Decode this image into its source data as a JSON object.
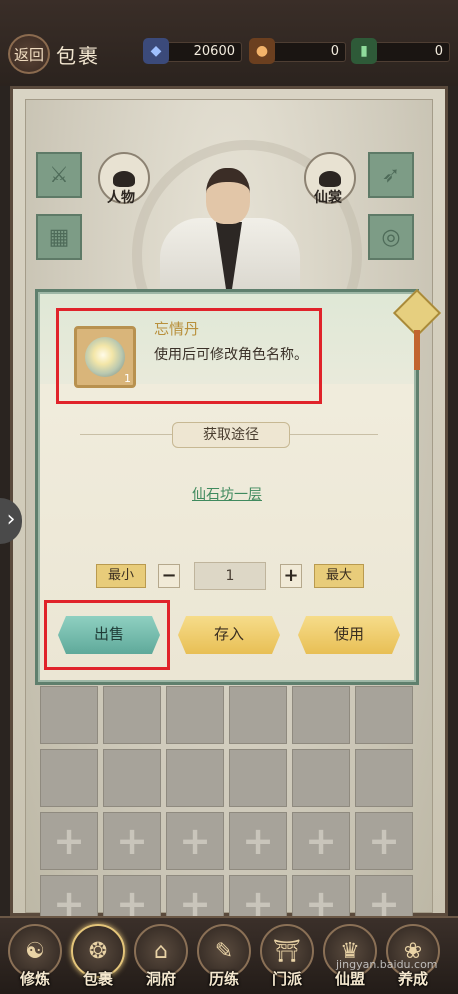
{
  "header": {
    "back_label": "返回",
    "title": "包裹",
    "currencies": [
      {
        "icon": "spirit-stone-icon",
        "value": "20600",
        "color": "#6b8bd6"
      },
      {
        "icon": "gold-ingot-icon",
        "value": "0",
        "color": "#d88a3a"
      },
      {
        "icon": "scroll-ticket-icon",
        "value": "0",
        "color": "#5fa36f"
      }
    ]
  },
  "tabs": {
    "character": "人物",
    "immortal_bag": "仙裳"
  },
  "item": {
    "name": "忘情丹",
    "description": "使用后可修改角色名称。",
    "count": "1"
  },
  "source": {
    "title": "获取途径",
    "link": "仙石坊一层"
  },
  "quantity": {
    "min_label": "最小",
    "minus": "−",
    "value": "1",
    "plus": "+",
    "max_label": "最大"
  },
  "actions": {
    "sell": "出售",
    "store": "存入",
    "use": "使用"
  },
  "grid": {
    "cells": [
      "",
      "",
      "",
      "",
      "",
      "",
      "",
      "",
      "",
      "",
      "",
      "",
      "+",
      "+",
      "+",
      "+",
      "+",
      "+",
      "+",
      "+",
      "+",
      "+",
      "+",
      "+"
    ]
  },
  "nav": {
    "items": [
      {
        "label": "修炼",
        "icon": "cultivation-icon"
      },
      {
        "label": "包裹",
        "icon": "bag-icon"
      },
      {
        "label": "洞府",
        "icon": "cave-icon"
      },
      {
        "label": "历练",
        "icon": "training-icon"
      },
      {
        "label": "门派",
        "icon": "sect-icon"
      },
      {
        "label": "仙盟",
        "icon": "alliance-icon"
      },
      {
        "label": "养成",
        "icon": "nurture-icon"
      }
    ]
  },
  "watermark": "jingyan.baidu.com"
}
